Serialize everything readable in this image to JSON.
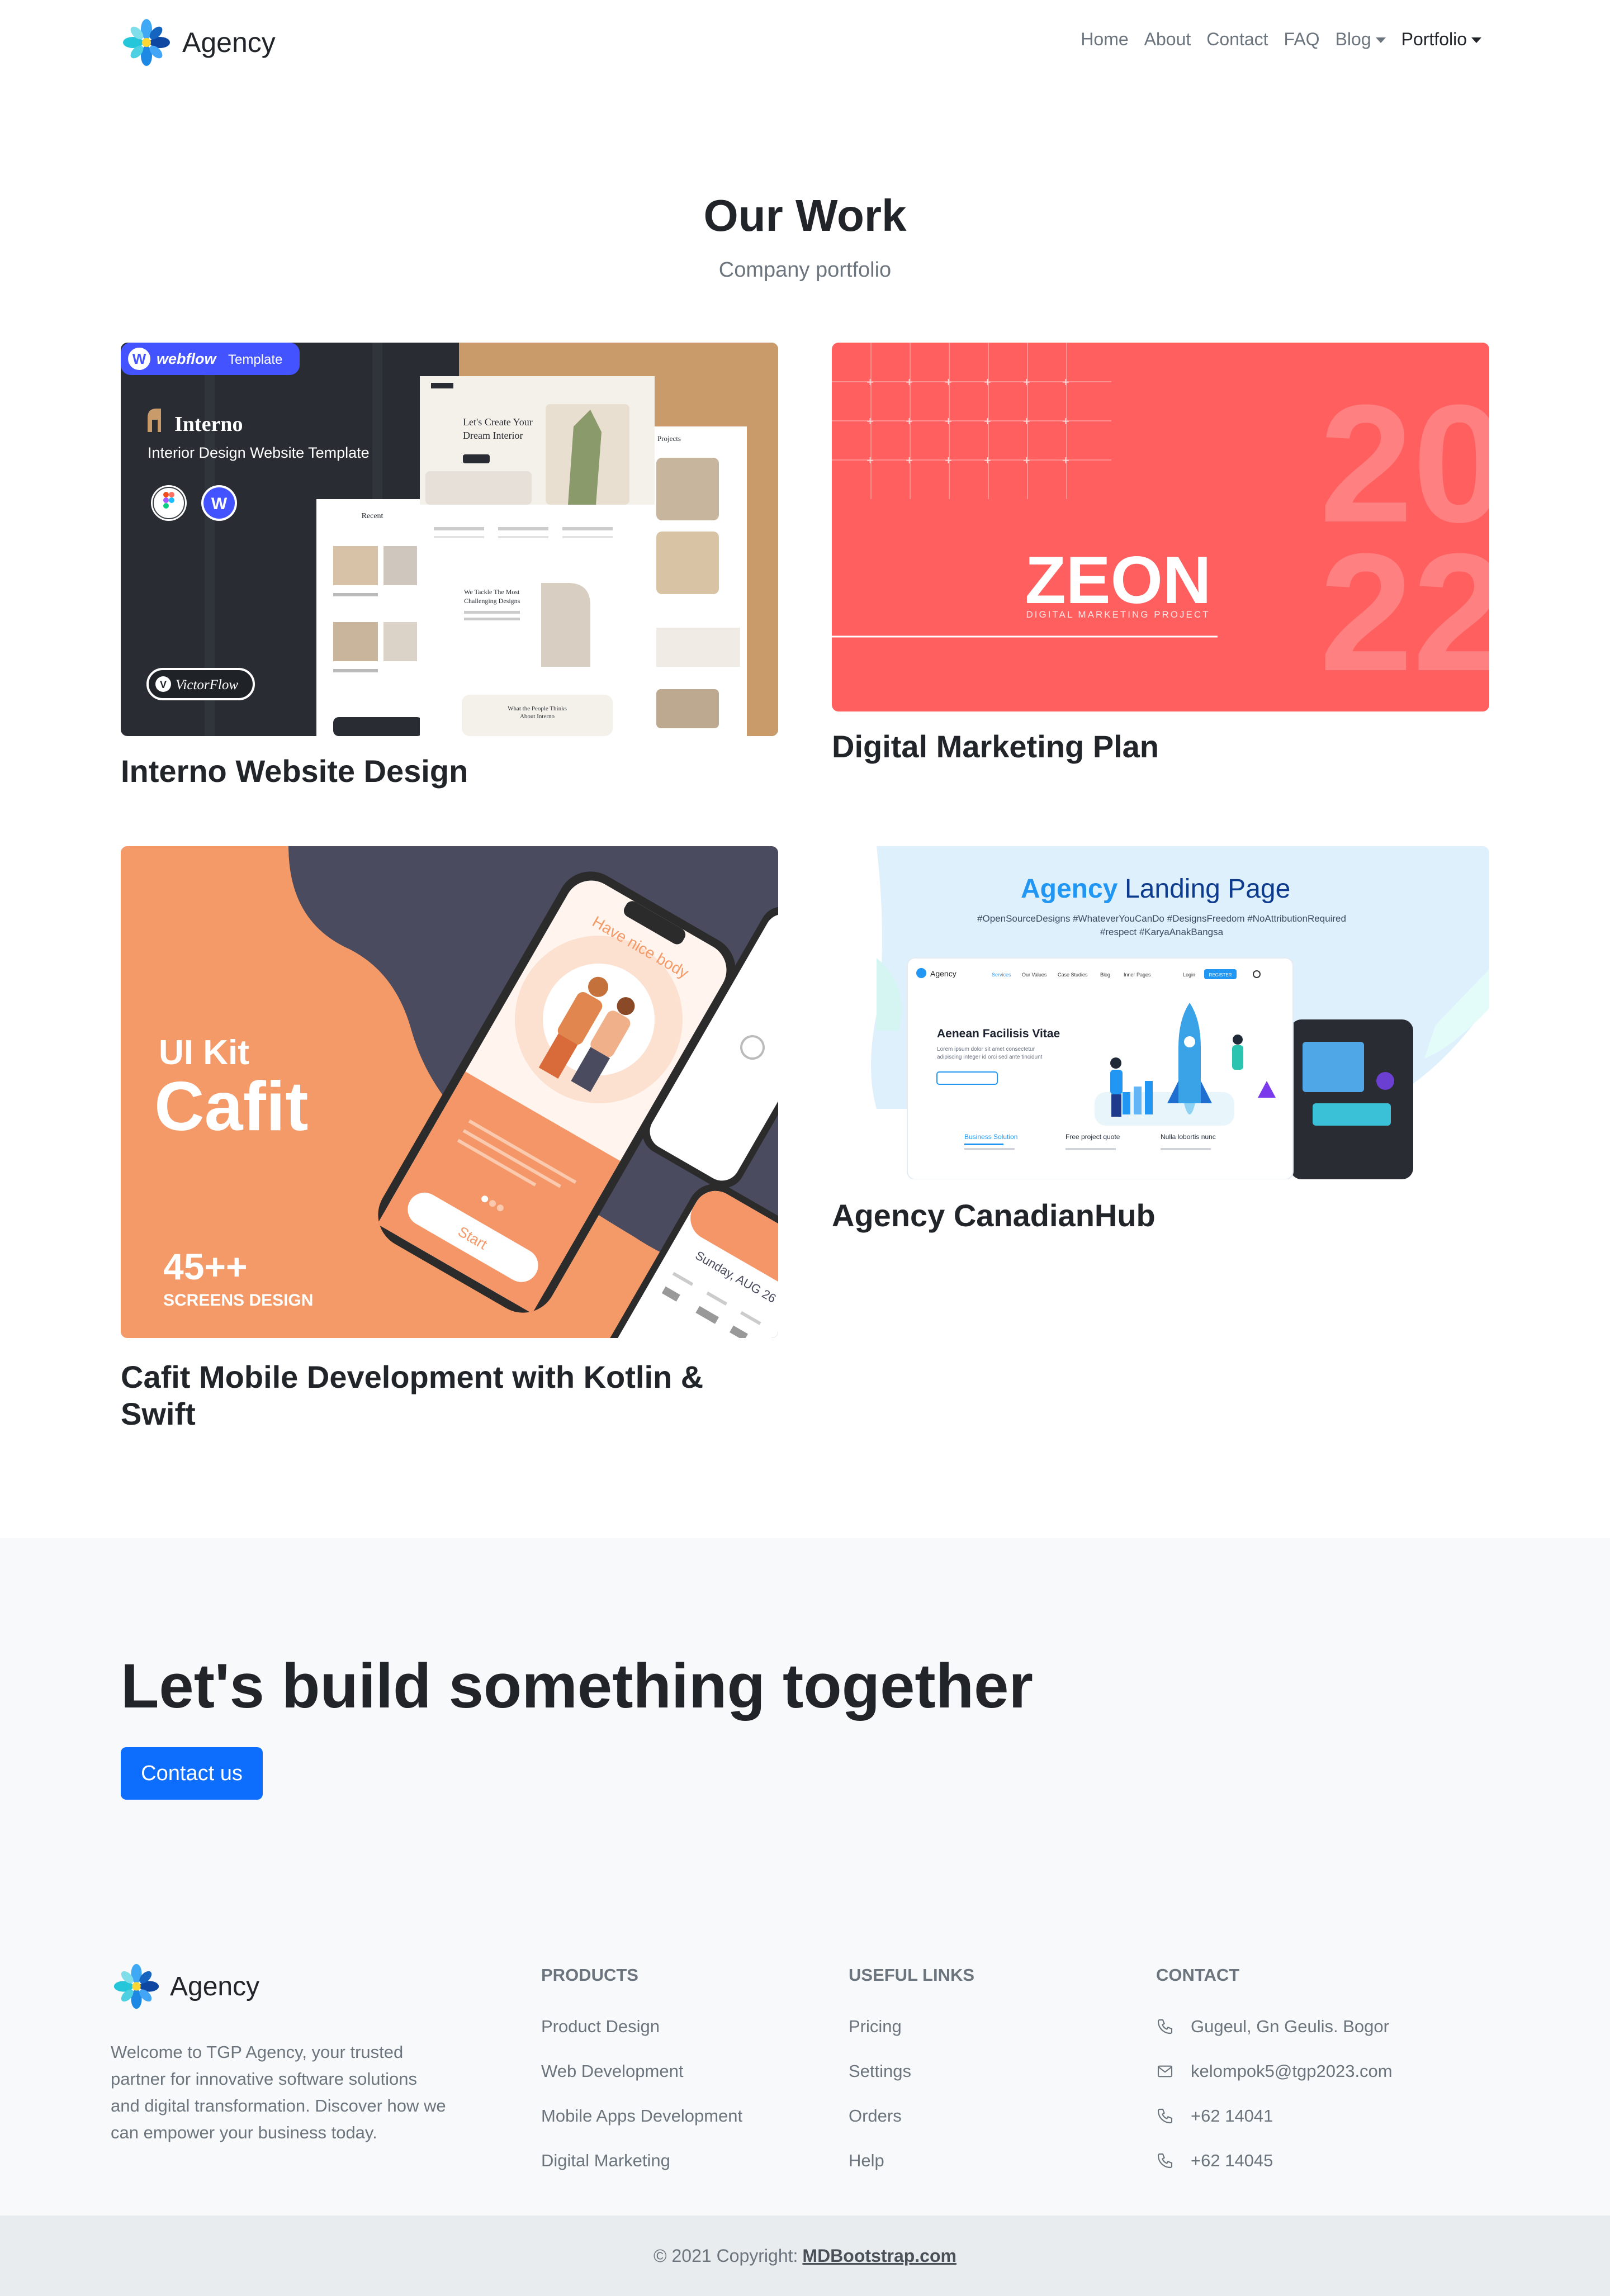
{
  "navbar": {
    "brand": "Agency",
    "links": [
      {
        "label": "Home"
      },
      {
        "label": "About"
      },
      {
        "label": "Contact"
      },
      {
        "label": "FAQ"
      },
      {
        "label": "Blog",
        "dropdown": true
      },
      {
        "label": "Portfolio",
        "dropdown": true,
        "active": true
      }
    ]
  },
  "work": {
    "title": "Our Work",
    "subtitle": "Company portfolio",
    "items": [
      {
        "title": "Interno Website Design",
        "thumb": {
          "badge_word": "webflow",
          "badge_suffix": "Template",
          "brand": "Interno",
          "tagline": "Interior Design Website Template",
          "author": "VictorFlow",
          "hero_heading_1": "Let's Create Your",
          "hero_heading_2": "Dream Interior",
          "section_heading_1": "We Tackle The Most",
          "section_heading_2": "Challenging Designs",
          "testimonials_1": "What the People Thinks",
          "testimonials_2": "About Interno",
          "recent_label": "Recent",
          "projects_label": "Projects"
        }
      },
      {
        "title": "Digital Marketing Plan",
        "thumb": {
          "brand": "ZEON",
          "tagline": "DIGITAL MARKETING PROJECT",
          "year_top": "20",
          "year_bottom": "22"
        }
      },
      {
        "title": "Cafit Mobile Development with Kotlin & Swift",
        "title_line1": "Cafit Mobile Development with Kotlin &",
        "title_line2": "Swift",
        "thumb": {
          "kit": "UI Kit",
          "name": "Cafit",
          "count": "45++",
          "caption": "SCREENS DESIGN",
          "phone_banner": "Have nice body",
          "phone_button": "Start",
          "date_label": "Sunday, AUG 26"
        }
      },
      {
        "title": "Agency CanadianHub",
        "thumb": {
          "heading_accent": "Agency",
          "heading_rest": "Landing Page",
          "tags_line1": "#OpenSourceDesigns #WhateverYouCanDo #DesignsFreedom  #NoAttributionRequired",
          "tags_line2": "#respect #KaryaAnakBangsa",
          "mock_brand": "Agency",
          "mock_headline": "Aenean Facilisis Vitae",
          "mock_col1": "Business Solution",
          "mock_col2": "Free project quote",
          "mock_col3": "Nulla lobortis nunc",
          "mock_nav": [
            "Services",
            "Our Values",
            "Case Studies",
            "Blog",
            "Inner Pages"
          ],
          "mock_login": "Login",
          "mock_register": "REGISTER",
          "mock_lorem": "Lorem ipsum dolor sit amet consectetur",
          "mock_lorem2": "adipiscing integer id orci sed ante tincidunt"
        }
      }
    ]
  },
  "cta": {
    "heading": "Let's build something together",
    "button": "Contact us"
  },
  "footer": {
    "brand": "Agency",
    "about": "Welcome to TGP Agency, your trusted partner for innovative software solutions and digital transformation. Discover how we can empower your business today.",
    "products": {
      "title": "PRODUCTS",
      "items": [
        "Product Design",
        "Web Development",
        "Mobile Apps Development",
        "Digital Marketing"
      ]
    },
    "useful_links": {
      "title": "USEFUL LINKS",
      "items": [
        "Pricing",
        "Settings",
        "Orders",
        "Help"
      ]
    },
    "contact": {
      "title": "CONTACT",
      "items": [
        {
          "icon": "phone-icon",
          "text": "Gugeul, Gn Geulis. Bogor"
        },
        {
          "icon": "envelope-icon",
          "text": "kelompok5@tgp2023.com"
        },
        {
          "icon": "phone-icon",
          "text": "+62 14041"
        },
        {
          "icon": "phone-icon",
          "text": "+62 14045"
        }
      ]
    },
    "copyright_prefix": "© 2021 Copyright:",
    "copyright_link": "MDBootstrap.com"
  },
  "colors": {
    "primary": "#0d6efd",
    "zeon_bg": "#ff5f5f",
    "cafit_orange": "#f7a173",
    "cafit_dark": "#4a4b5e",
    "interno_dark": "#292d33",
    "interno_tan": "#c99a6a",
    "webflow_blue": "#4353ff"
  }
}
